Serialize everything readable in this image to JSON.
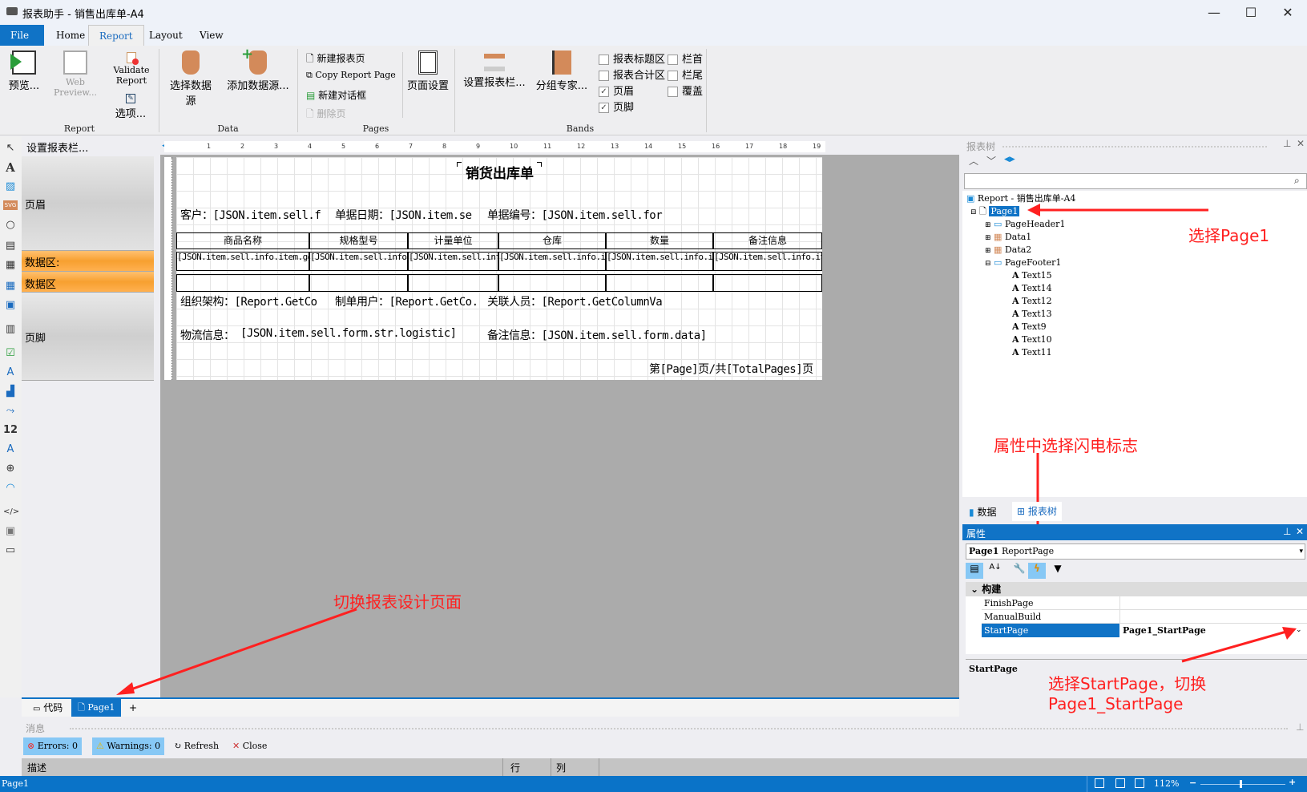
{
  "window": {
    "title": "报表助手 - 销售出库单-A4",
    "minimize": "—",
    "maximize": "☐",
    "close": "✕"
  },
  "menu_tabs": [
    {
      "label": "File"
    },
    {
      "label": "Home"
    },
    {
      "label": "Report"
    },
    {
      "label": "Layout"
    },
    {
      "label": "View"
    }
  ],
  "ribbon": {
    "report_group": {
      "label": "Report",
      "preview": "预览...",
      "web_preview": "Web Preview...",
      "validate": "Validate Report",
      "options": "选项..."
    },
    "data_group": {
      "label": "Data",
      "select_source": "选择数据源",
      "add_source": "添加数据源..."
    },
    "pages_group": {
      "label": "Pages",
      "new_page": "新建报表页",
      "copy_page": "Copy Report Page",
      "new_dialog": "新建对话框",
      "delete_page": "删除页",
      "page_setup": "页面设置"
    },
    "bands_group": {
      "label": "Bands",
      "configure": "设置报表栏...",
      "group_expert": "分组专家...",
      "checks": [
        {
          "label": "报表标题区",
          "checked": false
        },
        {
          "label": "报表合计区",
          "checked": false
        },
        {
          "label": "页眉",
          "checked": true
        },
        {
          "label": "页脚",
          "checked": true
        }
      ],
      "checks2": [
        {
          "label": "栏首",
          "checked": false
        },
        {
          "label": "栏尾",
          "checked": false
        },
        {
          "label": "覆盖",
          "checked": false
        }
      ]
    }
  },
  "band_panel": {
    "title": "设置报表栏...",
    "bands": [
      {
        "label": "页眉"
      },
      {
        "label": "数据区:"
      },
      {
        "label": "数据区"
      },
      {
        "label": "页脚"
      }
    ]
  },
  "ruler": {
    "ticks": [
      "1",
      "2",
      "3",
      "4",
      "5",
      "6",
      "7",
      "8",
      "9",
      "10",
      "11",
      "12",
      "13",
      "14",
      "15",
      "16",
      "17",
      "18",
      "19"
    ]
  },
  "report": {
    "title": "销货出库单",
    "header_fields": [
      "客户：[JSON.item.sell.f",
      "单据日期：[JSON.item.se",
      "单据编号：[JSON.item.sell.for"
    ],
    "columns": [
      "商品名称",
      "规格型号",
      "计量单位",
      "仓库",
      "数量",
      "备注信息"
    ],
    "row_cells": [
      "[JSON.item.sell.info.item.goods_data.name]",
      "[JSON.item.sell.info.item.str.spec]",
      "[JSON.item.sell.info.item.str.cell",
      "[JSON.item.sell.info.item.warehouse_data.n",
      "[JSON.item.sell.info.item.nums]",
      "[JSON.item.sell.info.item.data]"
    ],
    "footer_fields": [
      "组织架构：[Report.GetCo",
      "制单用户：[Report.GetCo.",
      "关联人员：[Report.GetColumnVa"
    ],
    "logistic_label": "物流信息：",
    "logistic_value": "[JSON.item.sell.form.str.logistic]",
    "remark": "备注信息：[JSON.item.sell.form.data]",
    "page_num": "第[Page]页/共[TotalPages]页"
  },
  "page_tabs": {
    "code": "代码",
    "page": "Page1",
    "add": "+"
  },
  "messages": {
    "title": "消息",
    "errors": "Errors: 0",
    "warnings": "Warnings: 0",
    "refresh": "Refresh",
    "close": "Close",
    "cols": [
      "描述",
      "行",
      "列"
    ]
  },
  "statusbar": {
    "left": "Page1",
    "zoom": "112%"
  },
  "tree": {
    "title": "报表树",
    "root": "Report - 销售出库单-A4",
    "nodes": [
      {
        "label": "Page1"
      },
      {
        "label": "PageHeader1"
      },
      {
        "label": "Data1"
      },
      {
        "label": "Data2"
      },
      {
        "label": "PageFooter1"
      }
    ],
    "texts": [
      "Text15",
      "Text14",
      "Text12",
      "Text13",
      "Text9",
      "Text10",
      "Text11"
    ],
    "tabs": [
      "数据",
      "报表树"
    ]
  },
  "props": {
    "title": "属性",
    "object": "Page1",
    "object_type": "ReportPage",
    "category": "构建",
    "rows": [
      {
        "name": "FinishPage",
        "value": ""
      },
      {
        "name": "ManualBuild",
        "value": ""
      },
      {
        "name": "StartPage",
        "value": "Page1_StartPage"
      }
    ],
    "desc": "StartPage"
  },
  "annotations": {
    "select_page": "选择Page1",
    "lightning": "属性中选择闪电标志",
    "switch_page": "切换报表设计页面",
    "start_page_1": "选择StartPage，切换",
    "start_page_2": "Page1_StartPage"
  }
}
